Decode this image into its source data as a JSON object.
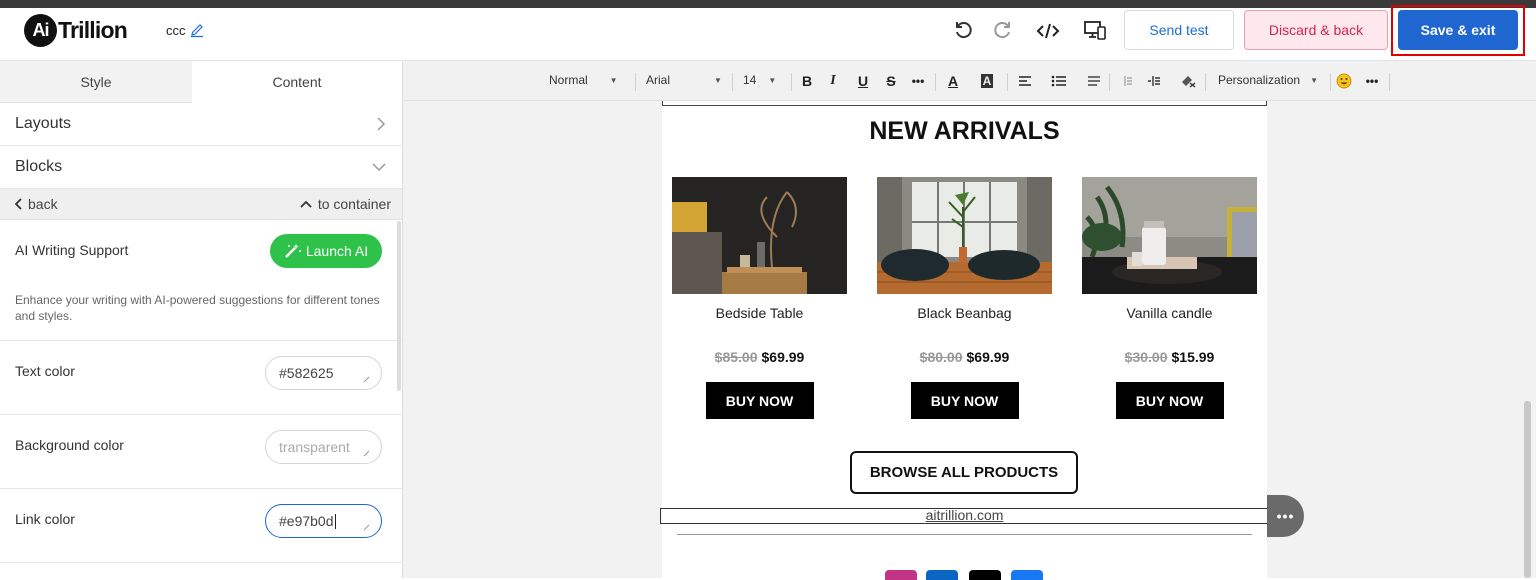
{
  "header": {
    "logo_badge": "Ai",
    "logo_text": "Trillion",
    "doc_name": "ccc",
    "send_test": "Send test",
    "discard": "Discard & back",
    "save": "Save & exit"
  },
  "sidebar": {
    "tabs": [
      "Style",
      "Content"
    ],
    "layouts": "Layouts",
    "blocks": "Blocks",
    "back": "back",
    "to_container": "to container",
    "ai_title": "AI Writing Support",
    "launch_ai": "Launch AI",
    "ai_desc": "Enhance your writing with AI-powered suggestions for different tones and styles.",
    "text_color_label": "Text color",
    "text_color_value": "#582625",
    "bg_color_label": "Background color",
    "bg_color_placeholder": "transparent",
    "link_color_label": "Link color",
    "link_color_value": "#e97b0d"
  },
  "toolbar": {
    "format": "Normal",
    "font": "Arial",
    "size": "14",
    "personalization": "Personalization"
  },
  "email": {
    "title": "NEW ARRIVALS",
    "products": [
      {
        "name": "Bedside Table",
        "old_price": "$85.00",
        "price": "$69.99",
        "cta": "BUY NOW"
      },
      {
        "name": "Black Beanbag",
        "old_price": "$80.00",
        "price": "$69.99",
        "cta": "BUY NOW"
      },
      {
        "name": "Vanilla candle",
        "old_price": "$30.00",
        "price": "$15.99",
        "cta": "BUY NOW"
      }
    ],
    "browse": "BROWSE ALL PRODUCTS",
    "link": "aitrillion.com",
    "more": "•••"
  },
  "colors": {
    "primary": "#1f66d1",
    "success": "#2ec24a",
    "discard": "#d3244f",
    "highlight": "#e10000"
  }
}
